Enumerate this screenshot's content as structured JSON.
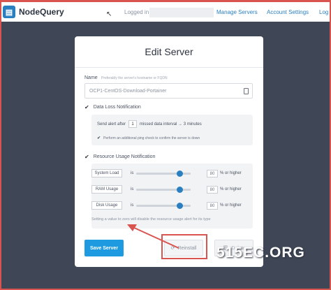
{
  "colors": {
    "accent": "#1e9be0",
    "brand": "#2a7fc1",
    "background": "#3f4756",
    "highlight": "#d9534f"
  },
  "header": {
    "logo_text": "NodeQuery",
    "logged_in": "Logged in as",
    "nav": [
      "Manage Servers",
      "Account Settings",
      "Log"
    ]
  },
  "card": {
    "title": "Edit Server",
    "name": {
      "label": "Name",
      "hint": "Preferably the server's hostname or FQDN",
      "value": "OCP1-CentOS-Download-Portainer"
    },
    "data_loss": {
      "checkbox_label": "Data Loss Notification",
      "checked": true,
      "alert_prefix": "Send alert after",
      "alert_count": "1",
      "alert_suffix": "missed data interval → 3 minutes",
      "ping_label": "Perform an additional ping check to confirm the server is down",
      "ping_checked": true
    },
    "resource_usage": {
      "checkbox_label": "Resource Usage Notification",
      "checked": true,
      "items": [
        {
          "label": "System Load",
          "is": "is",
          "value": "80",
          "suffix": "% or higher",
          "level": 0.8
        },
        {
          "label": "RAM Usage",
          "is": "is",
          "value": "80",
          "suffix": "% or higher",
          "level": 0.8
        },
        {
          "label": "Disk Usage",
          "is": "is",
          "value": "80",
          "suffix": "% or higher",
          "level": 0.8
        }
      ],
      "note": "Setting a value to zero will disable the resource usage alert for its type"
    },
    "buttons": {
      "save": "Save Server",
      "reinstall": "Reinstall",
      "delete": "Delete"
    }
  },
  "watermark": "515EC.ORG"
}
